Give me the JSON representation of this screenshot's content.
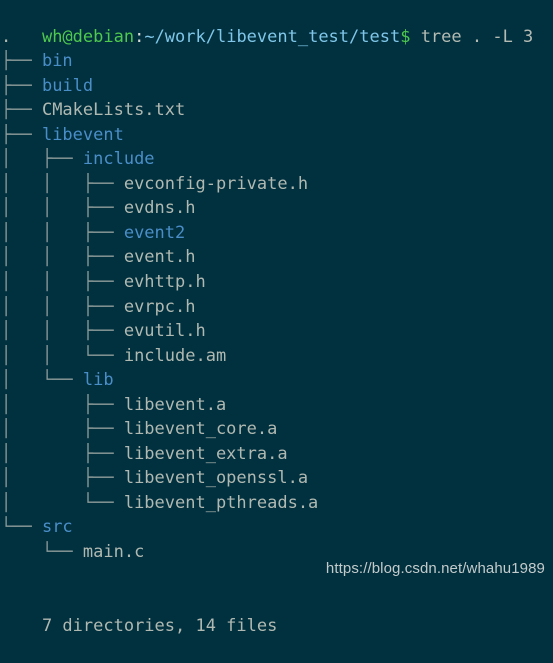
{
  "terminal": {
    "background_color": "#01303f",
    "prompt": {
      "user_host": "wh@debian",
      "separator": ":",
      "path": "~/work/libevent_test/test",
      "sigil": "$",
      "command": " tree . -L 3"
    },
    "colors": {
      "user_host": "#4ec94e",
      "path": "#7fc6e8",
      "command": "#b3bbb3",
      "directory": "#4a8ec8",
      "file": "#b0b9b1",
      "branch": "#8c9a99",
      "summary": "#b0b9b1",
      "watermark": "#c3cbcb"
    },
    "tree": [
      {
        "branch": "",
        "name": ".",
        "type": "root"
      },
      {
        "branch": "├── ",
        "name": "bin",
        "type": "dir"
      },
      {
        "branch": "├── ",
        "name": "build",
        "type": "dir"
      },
      {
        "branch": "├── ",
        "name": "CMakeLists.txt",
        "type": "file"
      },
      {
        "branch": "├── ",
        "name": "libevent",
        "type": "dir"
      },
      {
        "branch": "│   ├── ",
        "name": "include",
        "type": "dir"
      },
      {
        "branch": "│   │   ├── ",
        "name": "evconfig-private.h",
        "type": "file"
      },
      {
        "branch": "│   │   ├── ",
        "name": "evdns.h",
        "type": "file"
      },
      {
        "branch": "│   │   ├── ",
        "name": "event2",
        "type": "dir"
      },
      {
        "branch": "│   │   ├── ",
        "name": "event.h",
        "type": "file"
      },
      {
        "branch": "│   │   ├── ",
        "name": "evhttp.h",
        "type": "file"
      },
      {
        "branch": "│   │   ├── ",
        "name": "evrpc.h",
        "type": "file"
      },
      {
        "branch": "│   │   ├── ",
        "name": "evutil.h",
        "type": "file"
      },
      {
        "branch": "│   │   └── ",
        "name": "include.am",
        "type": "file"
      },
      {
        "branch": "│   └── ",
        "name": "lib",
        "type": "dir"
      },
      {
        "branch": "│       ├── ",
        "name": "libevent.a",
        "type": "file"
      },
      {
        "branch": "│       ├── ",
        "name": "libevent_core.a",
        "type": "file"
      },
      {
        "branch": "│       ├── ",
        "name": "libevent_extra.a",
        "type": "file"
      },
      {
        "branch": "│       ├── ",
        "name": "libevent_openssl.a",
        "type": "file"
      },
      {
        "branch": "│       └── ",
        "name": "libevent_pthreads.a",
        "type": "file"
      },
      {
        "branch": "└── ",
        "name": "src",
        "type": "dir"
      },
      {
        "branch": "    └── ",
        "name": "main.c",
        "type": "file"
      }
    ],
    "summary": "7 directories, 14 files",
    "watermark": "https://blog.csdn.net/whahu1989"
  }
}
